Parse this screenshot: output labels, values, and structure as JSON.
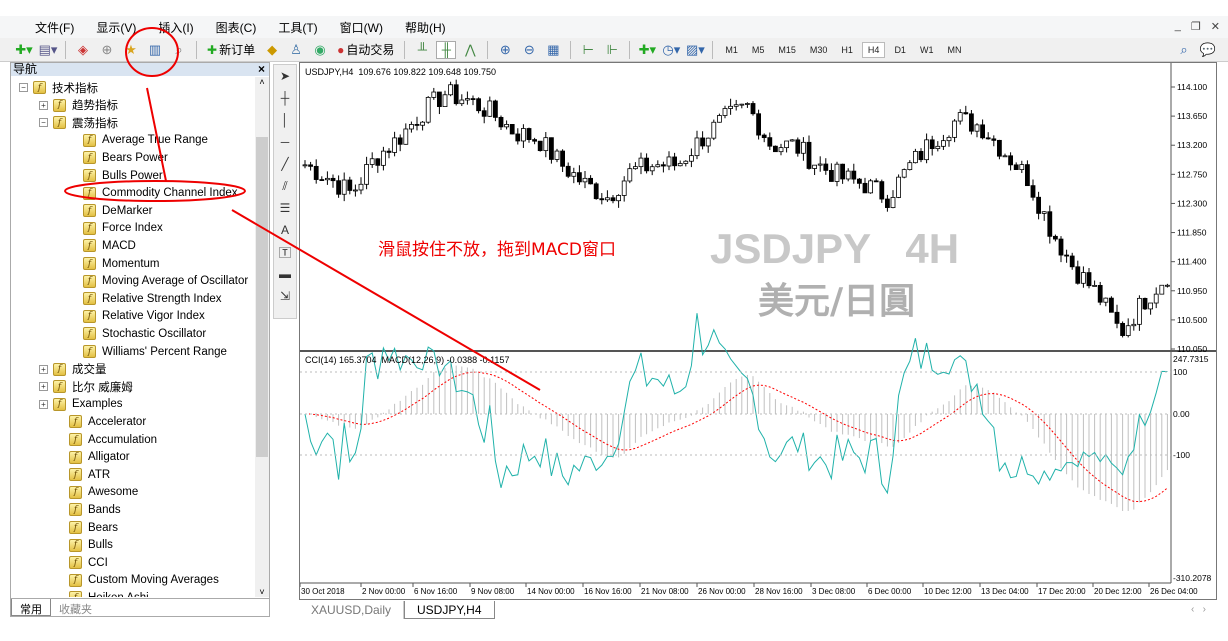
{
  "menu": [
    "文件(F)",
    "显示(V)",
    "插入(I)",
    "图表(C)",
    "工具(T)",
    "窗口(W)",
    "帮助(H)"
  ],
  "toolbar": {
    "new_order": "新订单",
    "auto_trading": "自动交易",
    "timeframes": [
      "M1",
      "M5",
      "M15",
      "M30",
      "H1",
      "H4",
      "D1",
      "W1",
      "MN"
    ],
    "active_timeframe": "H4"
  },
  "navigator": {
    "title": "导航",
    "items": [
      {
        "label": "技术指标",
        "level": 0,
        "expander": "minus"
      },
      {
        "label": "趋势指标",
        "level": 1,
        "expander": "plus"
      },
      {
        "label": "震荡指标",
        "level": 1,
        "expander": "minus"
      },
      {
        "label": "Average True Range",
        "level": 2
      },
      {
        "label": "Bears Power",
        "level": 2
      },
      {
        "label": "Bulls Power",
        "level": 2
      },
      {
        "label": "Commodity Channel Index",
        "level": 2
      },
      {
        "label": "DeMarker",
        "level": 2
      },
      {
        "label": "Force Index",
        "level": 2
      },
      {
        "label": "MACD",
        "level": 2
      },
      {
        "label": "Momentum",
        "level": 2
      },
      {
        "label": "Moving Average of Oscillator",
        "level": 2
      },
      {
        "label": "Relative Strength Index",
        "level": 2
      },
      {
        "label": "Relative Vigor Index",
        "level": 2
      },
      {
        "label": "Stochastic Oscillator",
        "level": 2
      },
      {
        "label": "Williams' Percent Range",
        "level": 2
      },
      {
        "label": "成交量",
        "level": 1,
        "expander": "plus"
      },
      {
        "label": "比尔 威廉姆",
        "level": 1,
        "expander": "plus"
      },
      {
        "label": "Examples",
        "level": 1,
        "expander": "plus"
      },
      {
        "label": "Accelerator",
        "level": 1,
        "custom": true
      },
      {
        "label": "Accumulation",
        "level": 1,
        "custom": true
      },
      {
        "label": "Alligator",
        "level": 1,
        "custom": true
      },
      {
        "label": "ATR",
        "level": 1,
        "custom": true
      },
      {
        "label": "Awesome",
        "level": 1,
        "custom": true
      },
      {
        "label": "Bands",
        "level": 1,
        "custom": true
      },
      {
        "label": "Bears",
        "level": 1,
        "custom": true
      },
      {
        "label": "Bulls",
        "level": 1,
        "custom": true
      },
      {
        "label": "CCI",
        "level": 1,
        "custom": true
      },
      {
        "label": "Custom Moving Averages",
        "level": 1,
        "custom": true
      },
      {
        "label": "Heiken Ashi",
        "level": 1,
        "custom": true
      }
    ],
    "tabs": [
      "常用",
      "收藏夹"
    ]
  },
  "chart": {
    "header": "USDJPY,H4  109.676 109.822 109.648 109.750",
    "price_ticks": [
      "114.100",
      "113.650",
      "113.200",
      "112.750",
      "112.300",
      "111.850",
      "111.400",
      "110.950",
      "110.500",
      "110.050"
    ],
    "indicator_header": "CCI(14) 165.3704  MACD(12,26,9) -0.0388 -0.1157",
    "indicator_ticks": [
      "247.7315",
      "100",
      "0.00",
      "-100",
      "-310.2078"
    ],
    "time_ticks": [
      "30 Oct 2018",
      "2 Nov 00:00",
      "6 Nov 16:00",
      "9 Nov 08:00",
      "14 Nov 00:00",
      "16 Nov 16:00",
      "21 Nov 08:00",
      "26 Nov 00:00",
      "28 Nov 16:00",
      "3 Dec 08:00",
      "6 Dec 00:00",
      "10 Dec 12:00",
      "13 Dec 04:00",
      "17 Dec 20:00",
      "20 Dec 12:00",
      "26 Dec 04:00"
    ],
    "price_path": [
      112.9,
      112.7,
      112.45,
      113.0,
      113.3,
      113.7,
      114.0,
      113.9,
      113.7,
      113.4,
      113.3,
      112.9,
      112.6,
      112.4,
      112.8,
      112.9,
      112.9,
      113.3,
      113.6,
      113.8,
      113.2,
      113.2,
      112.9,
      112.7,
      112.6,
      112.4,
      112.9,
      113.3,
      113.6,
      113.5,
      113.1,
      112.7,
      111.9,
      111.3,
      110.9,
      110.3,
      110.8,
      111.2
    ],
    "watermark_symbol": "JSDJPY   4H",
    "watermark_name": "美元/日圓",
    "candle_color": "#000000",
    "cci_color": "#20b2aa",
    "signal_color": "#ff0000",
    "histogram_color": "#c0c0c0"
  },
  "annotation": {
    "text": "滑鼠按住不放，拖到MACD窗口",
    "color": "#ff0000"
  },
  "tabs": [
    "XAUUSD,Daily",
    "USDJPY,H4"
  ],
  "active_tab": "USDJPY,H4"
}
